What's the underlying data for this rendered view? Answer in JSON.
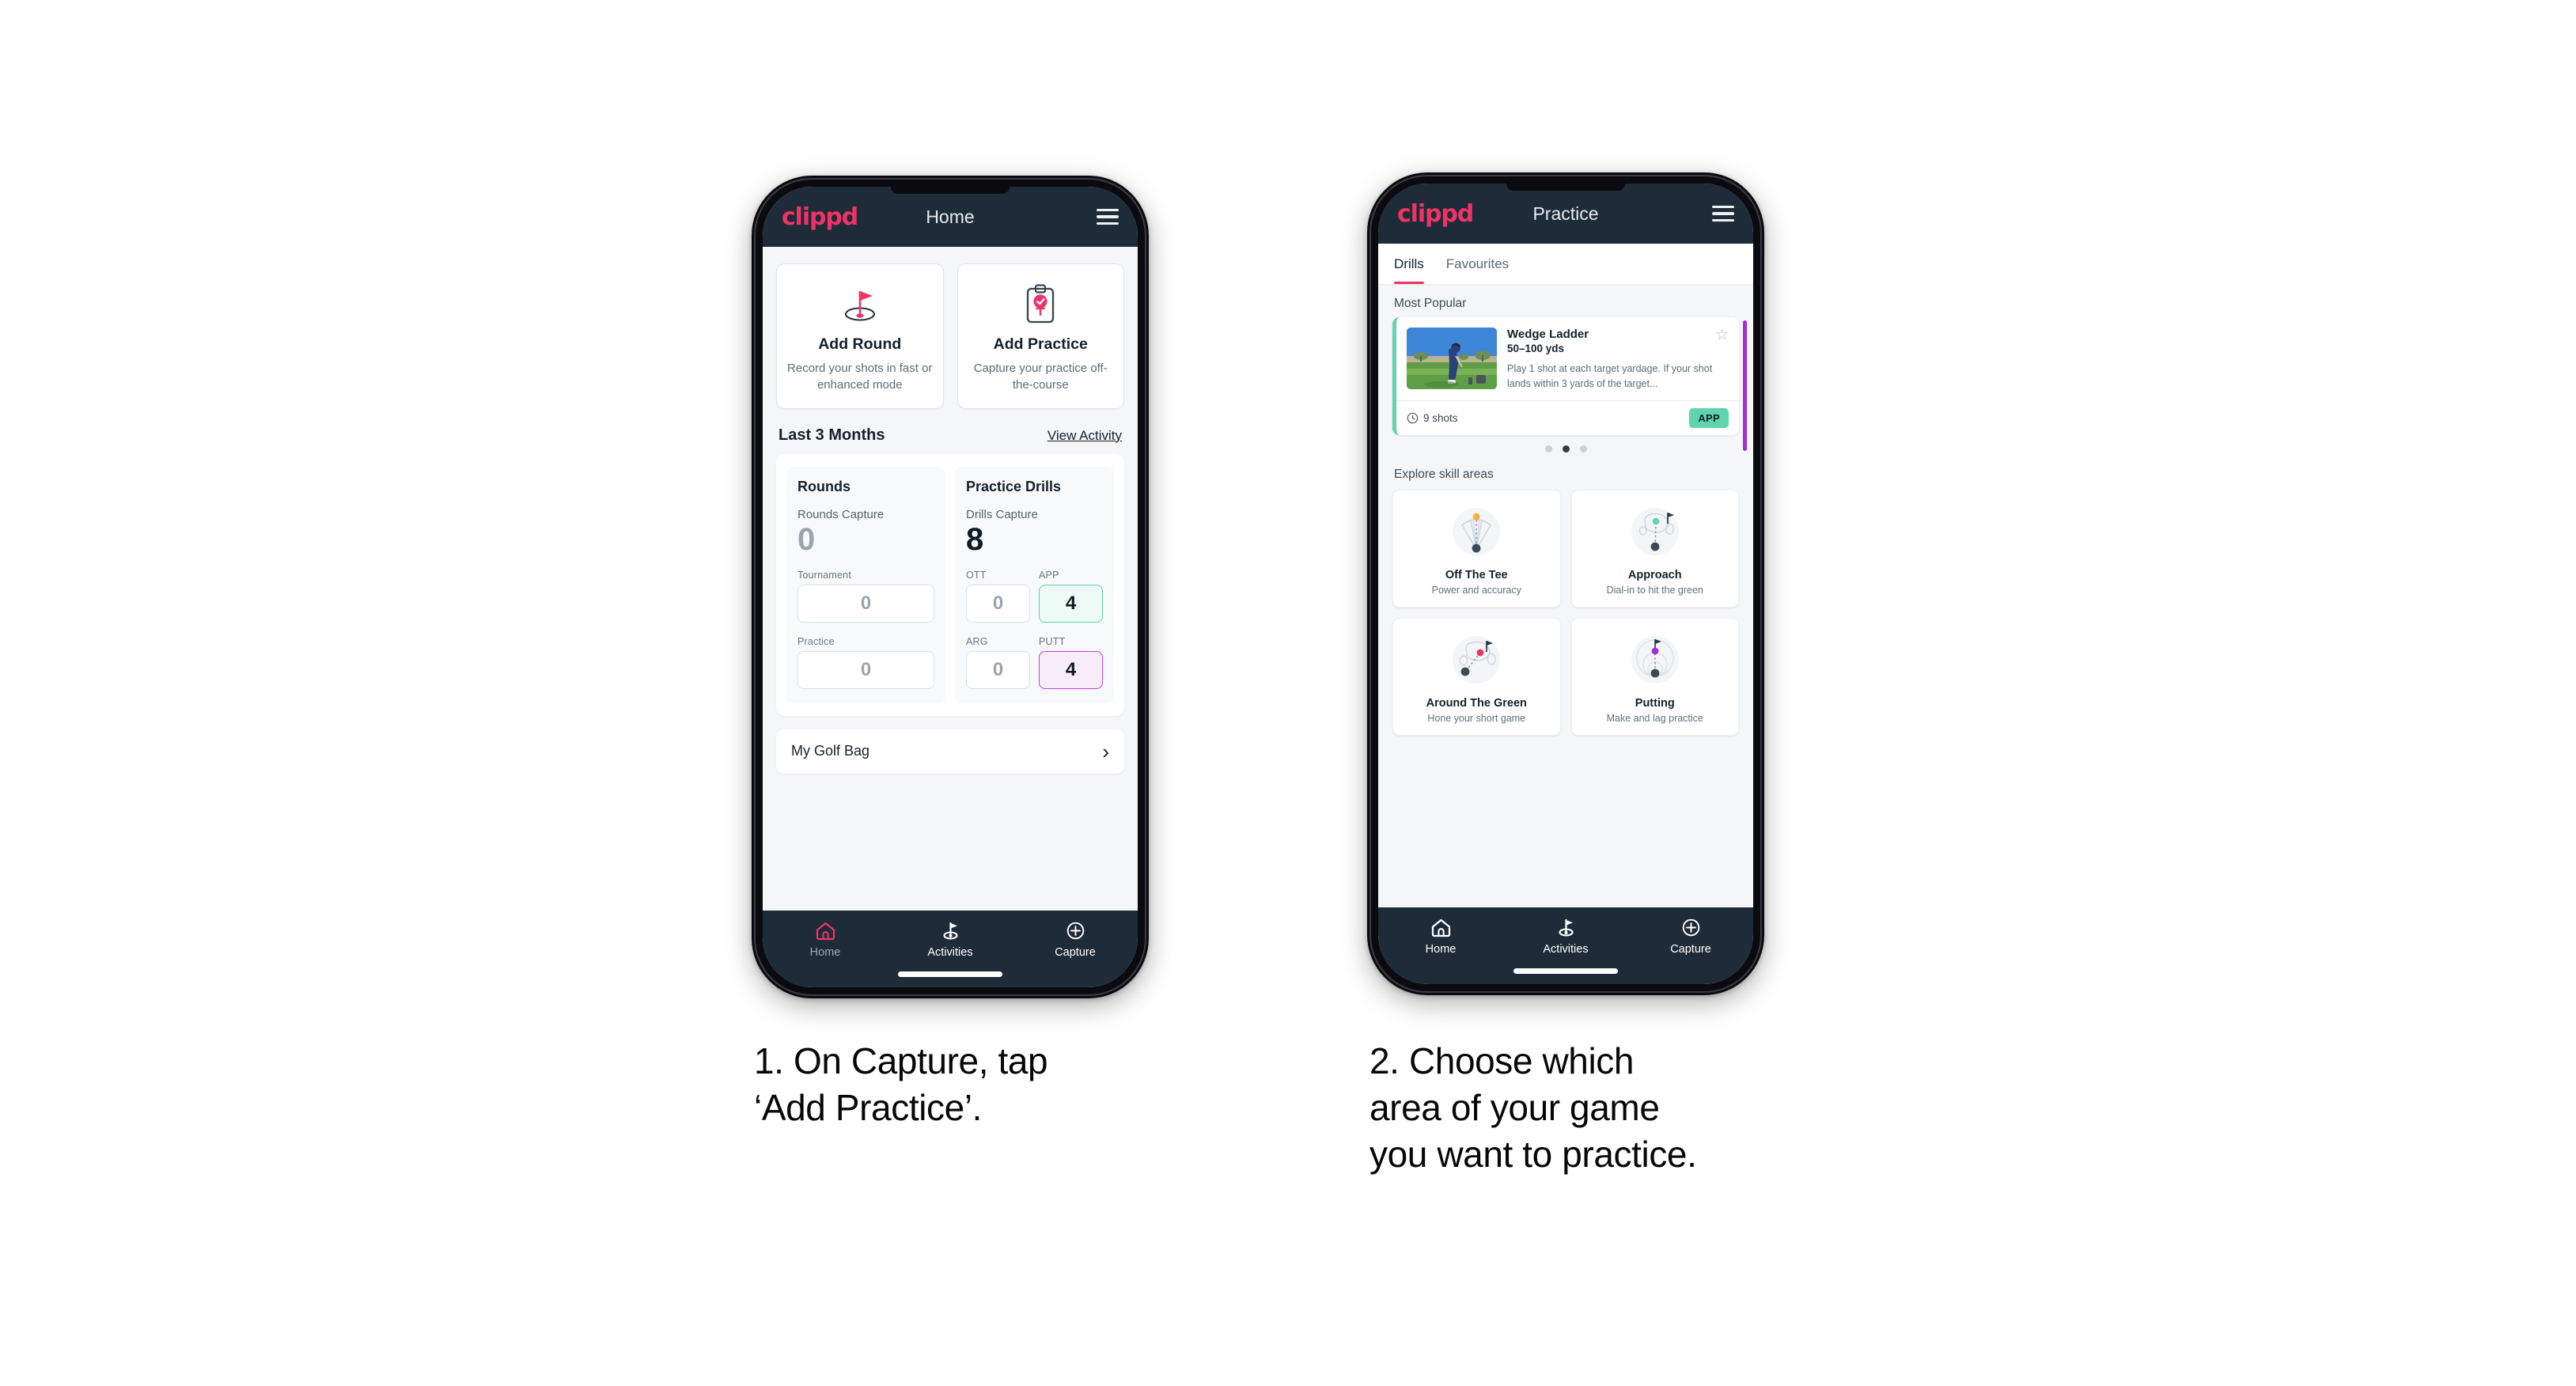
{
  "brand": "clippd",
  "phone1": {
    "header": {
      "title": "Home",
      "menu_icon": "hamburger-icon"
    },
    "actions": [
      {
        "icon": "golf-flag-hole-icon",
        "title": "Add Round",
        "subtitle": "Record your shots in fast or enhanced mode"
      },
      {
        "icon": "clipboard-check-icon",
        "title": "Add Practice",
        "subtitle": "Capture your practice off-the-course"
      }
    ],
    "section": {
      "title": "Last 3 Months",
      "link": "View Activity"
    },
    "stats": {
      "rounds": {
        "heading": "Rounds",
        "capture_label": "Rounds Capture",
        "capture_value": "0",
        "items": [
          {
            "label": "Tournament",
            "value": "0",
            "highlight": "none"
          },
          {
            "label": "Practice",
            "value": "0",
            "highlight": "none"
          }
        ]
      },
      "drills": {
        "heading": "Practice Drills",
        "capture_label": "Drills Capture",
        "capture_value": "8",
        "items": [
          {
            "label": "OTT",
            "value": "0",
            "highlight": "none"
          },
          {
            "label": "APP",
            "value": "4",
            "highlight": "green"
          },
          {
            "label": "ARG",
            "value": "0",
            "highlight": "none"
          },
          {
            "label": "PUTT",
            "value": "4",
            "highlight": "purple"
          }
        ]
      }
    },
    "golf_bag": {
      "label": "My Golf Bag",
      "chevron": "chevron-right-icon"
    },
    "bottom_nav": [
      {
        "label": "Home",
        "icon": "home-icon",
        "active": true
      },
      {
        "label": "Activities",
        "icon": "golf-flag-icon",
        "active": false
      },
      {
        "label": "Capture",
        "icon": "plus-circle-icon",
        "active": false
      }
    ]
  },
  "phone2": {
    "header": {
      "title": "Practice",
      "menu_icon": "hamburger-icon"
    },
    "tabs": [
      {
        "label": "Drills",
        "active": true
      },
      {
        "label": "Favourites",
        "active": false
      }
    ],
    "most_popular_label": "Most Popular",
    "drill": {
      "name": "Wedge Ladder",
      "yardage": "50–100 yds",
      "description": "Play 1 shot at each target yardage. If your shot lands within 3 yards of the target...",
      "shots": "9 shots",
      "badge": "APP",
      "star_icon": "star-outline-icon",
      "clock_icon": "clock-icon",
      "thumbnail": "golfer-hitting-wedge-photo"
    },
    "carousel_dots": {
      "count": 3,
      "active_index": 1
    },
    "explore_label": "Explore skill areas",
    "skill_areas": [
      {
        "name": "Off The Tee",
        "subtitle": "Power and accuracy",
        "art": "tee-shot-dispersion-icon",
        "accent": "#f5b13d"
      },
      {
        "name": "Approach",
        "subtitle": "Dial-in to hit the green",
        "art": "approach-green-icon",
        "accent": "#5fd4ae"
      },
      {
        "name": "Around The Green",
        "subtitle": "Hone your short game",
        "art": "chip-green-icon",
        "accent": "#e8375f"
      },
      {
        "name": "Putting",
        "subtitle": "Make and lag practice",
        "art": "putting-rings-icon",
        "accent": "#9f2fd6"
      }
    ],
    "bottom_nav": [
      {
        "label": "Home",
        "icon": "home-icon",
        "active": false
      },
      {
        "label": "Activities",
        "icon": "golf-flag-icon",
        "active": true
      },
      {
        "label": "Capture",
        "icon": "plus-circle-icon",
        "active": false
      }
    ]
  },
  "captions": {
    "step1": "1. On Capture, tap\n‘Add Practice’.",
    "step2": "2. Choose which\narea of your game\nyou want to practice."
  },
  "colors": {
    "brand_pink": "#ee3465",
    "nav_dark": "#1e2b38",
    "accent_green": "#5fd4ae",
    "accent_purple": "#9f2fd6",
    "page_bg": "#f4f6f8"
  }
}
